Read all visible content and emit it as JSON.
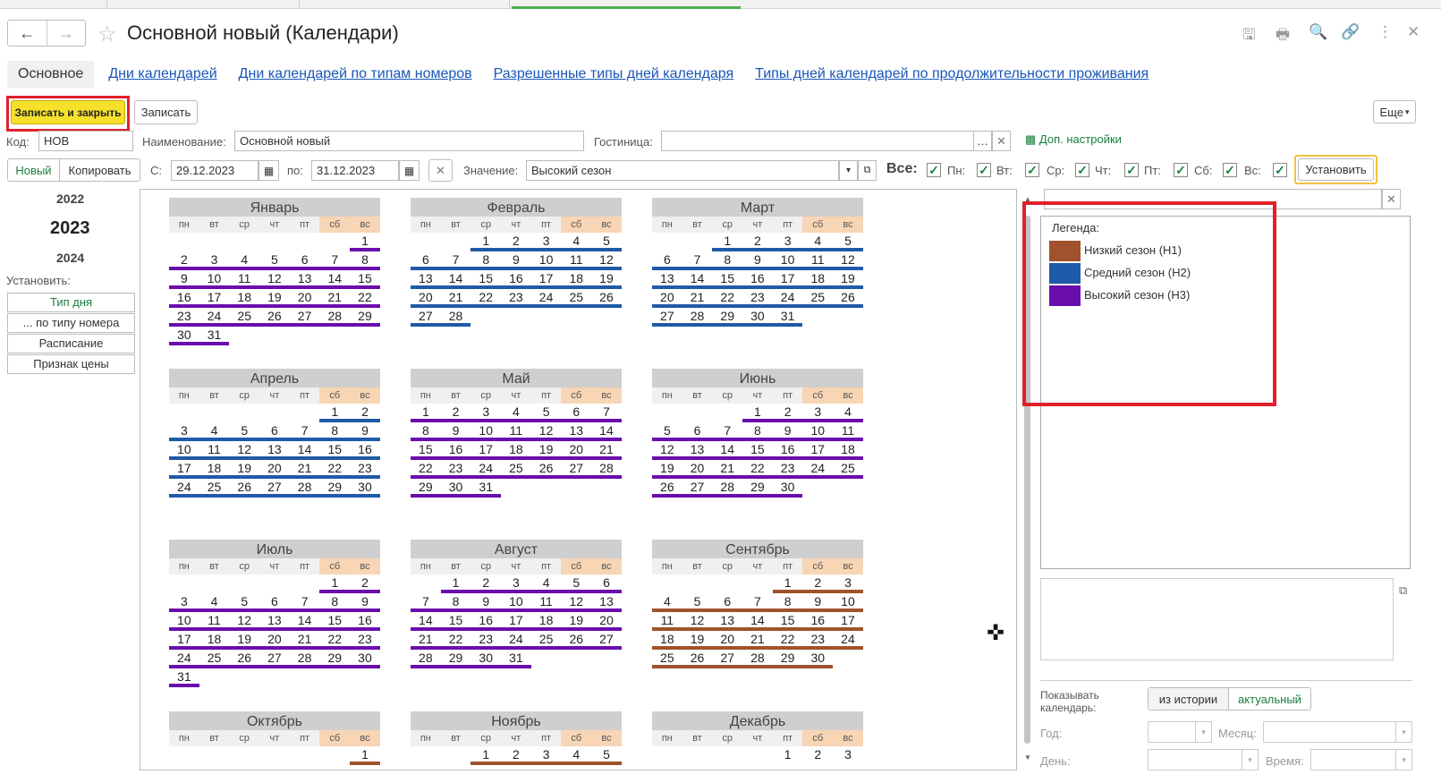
{
  "window": {
    "title": "Основной новый (Календари)"
  },
  "tabs": [
    {
      "label": "Основное"
    },
    {
      "label": "Дни календарей"
    },
    {
      "label": "Дни календарей по типам номеров"
    },
    {
      "label": "Разрешенные типы дней календаря"
    },
    {
      "label": "Типы дней календарей по продолжительности проживания"
    }
  ],
  "toolbar": {
    "save_close": "Записать и закрыть",
    "save": "Записать",
    "more": "Еще"
  },
  "form": {
    "code_label": "Код:",
    "code_value": "НОВ",
    "name_label": "Наименование:",
    "name_value": "Основной новый",
    "hotel_label": "Гостиница:",
    "hotel_value": "",
    "extra_settings": "Доп. настройки",
    "new_btn": "Новый",
    "copy_btn": "Копировать",
    "from_label": "С:",
    "from_value": "29.12.2023",
    "to_label": "по:",
    "to_value": "31.12.2023",
    "value_label": "Значение:",
    "value_value": "Высокий сезон",
    "all_label": "Все:",
    "set_btn": "Установить",
    "days": [
      "Пн:",
      "Вт:",
      "Ср:",
      "Чт:",
      "Пт:",
      "Сб:",
      "Вс:"
    ]
  },
  "years": {
    "prev": "2022",
    "current": "2023",
    "next": "2024"
  },
  "side": {
    "set_label": "Установить:",
    "items": [
      "Тип дня",
      "... по типу номера",
      "Расписание",
      "Признак цены"
    ]
  },
  "legend": {
    "title": "Легенда:",
    "items": [
      {
        "label": "Низкий сезон (Н1)",
        "color": "#a0522d"
      },
      {
        "label": "Средний сезон (Н2)",
        "color": "#1f5aa8"
      },
      {
        "label": "Высокий сезон (Н3)",
        "color": "#6a0dad"
      }
    ]
  },
  "show": {
    "label_line1": "Показывать",
    "label_line2": "календарь:",
    "history_btn": "из истории",
    "actual_btn": "актуальный",
    "year_label": "Год:",
    "month_label": "Месяц:",
    "day_label": "День:",
    "time_label": "Время:"
  },
  "weekdays": [
    "пн",
    "вт",
    "ср",
    "чт",
    "пт",
    "сб",
    "вс"
  ],
  "months": [
    {
      "name": "Январь",
      "start": 6,
      "len": 31,
      "seasons": [
        "Н3",
        "Н3",
        "Н3",
        "Н3",
        "Н3",
        "Н3",
        "Н3",
        "Н3",
        "Н3",
        "Н3",
        "Н3",
        "Н3",
        "Н3",
        "Н3",
        "Н3",
        "Н3",
        "Н3",
        "Н3",
        "Н3",
        "Н3",
        "Н3",
        "Н3",
        "Н3",
        "Н3",
        "Н3",
        "Н3",
        "Н3",
        "Н3",
        "Н3",
        "Н3",
        "Н3"
      ]
    },
    {
      "name": "Февраль",
      "start": 2,
      "len": 28,
      "seasons": [
        "Н2",
        "Н2",
        "Н2",
        "Н2",
        "Н2",
        "Н2",
        "Н2",
        "Н2",
        "Н2",
        "Н2",
        "Н2",
        "Н2",
        "Н2",
        "Н2",
        "Н2",
        "Н2",
        "Н2",
        "Н2",
        "Н2",
        "Н2",
        "Н2",
        "Н2",
        "Н2",
        "Н2",
        "Н2",
        "Н2",
        "Н2",
        "Н2"
      ]
    },
    {
      "name": "Март",
      "start": 2,
      "len": 31,
      "seasons": [
        "Н2",
        "Н2",
        "Н2",
        "Н2",
        "Н2",
        "Н2",
        "Н2",
        "Н2",
        "Н2",
        "Н2",
        "Н2",
        "Н2",
        "Н2",
        "Н2",
        "Н2",
        "Н2",
        "Н2",
        "Н2",
        "Н2",
        "Н2",
        "Н2",
        "Н2",
        "Н2",
        "Н2",
        "Н2",
        "Н2",
        "Н2",
        "Н2",
        "Н2",
        "Н2",
        "Н2"
      ]
    },
    {
      "name": "Апрель",
      "start": 5,
      "len": 30,
      "seasons": [
        "Н2",
        "Н2",
        "Н2",
        "Н2",
        "Н2",
        "Н2",
        "Н2",
        "Н2",
        "Н2",
        "Н2",
        "Н2",
        "Н2",
        "Н2",
        "Н2",
        "Н2",
        "Н2",
        "Н2",
        "Н2",
        "Н2",
        "Н2",
        "Н2",
        "Н2",
        "Н2",
        "Н2",
        "Н2",
        "Н2",
        "Н2",
        "Н2",
        "Н2",
        "Н2"
      ]
    },
    {
      "name": "Май",
      "start": 0,
      "len": 31,
      "seasons": [
        "Н3",
        "Н3",
        "Н3",
        "Н3",
        "Н3",
        "Н3",
        "Н3",
        "Н3",
        "Н3",
        "Н3",
        "Н3",
        "Н3",
        "Н3",
        "Н3",
        "Н3",
        "Н3",
        "Н3",
        "Н3",
        "Н3",
        "Н3",
        "Н3",
        "Н3",
        "Н3",
        "Н3",
        "Н3",
        "Н3",
        "Н3",
        "Н3",
        "Н3",
        "Н3",
        "Н3"
      ]
    },
    {
      "name": "Июнь",
      "start": 3,
      "len": 30,
      "seasons": [
        "Н3",
        "Н3",
        "Н3",
        "Н3",
        "Н3",
        "Н3",
        "Н3",
        "Н3",
        "Н3",
        "Н3",
        "Н3",
        "Н3",
        "Н3",
        "Н3",
        "Н3",
        "Н3",
        "Н3",
        "Н3",
        "Н3",
        "Н3",
        "Н3",
        "Н3",
        "Н3",
        "Н3",
        "Н3",
        "Н3",
        "Н3",
        "Н3",
        "Н3",
        "Н3"
      ]
    },
    {
      "name": "Июль",
      "start": 5,
      "len": 31,
      "seasons": [
        "Н3",
        "Н3",
        "Н3",
        "Н3",
        "Н3",
        "Н3",
        "Н3",
        "Н3",
        "Н3",
        "Н3",
        "Н3",
        "Н3",
        "Н3",
        "Н3",
        "Н3",
        "Н3",
        "Н3",
        "Н3",
        "Н3",
        "Н3",
        "Н3",
        "Н3",
        "Н3",
        "Н3",
        "Н3",
        "Н3",
        "Н3",
        "Н3",
        "Н3",
        "Н3",
        "Н3"
      ]
    },
    {
      "name": "Август",
      "start": 1,
      "len": 31,
      "seasons": [
        "Н3",
        "Н3",
        "Н3",
        "Н3",
        "Н3",
        "Н3",
        "Н3",
        "Н3",
        "Н3",
        "Н3",
        "Н3",
        "Н3",
        "Н3",
        "Н3",
        "Н3",
        "Н3",
        "Н3",
        "Н3",
        "Н3",
        "Н3",
        "Н3",
        "Н3",
        "Н3",
        "Н3",
        "Н3",
        "Н3",
        "Н3",
        "Н3",
        "Н3",
        "Н3",
        "Н3"
      ]
    },
    {
      "name": "Сентябрь",
      "start": 4,
      "len": 30,
      "seasons": [
        "Н1",
        "Н1",
        "Н1",
        "Н1",
        "Н1",
        "Н1",
        "Н1",
        "Н1",
        "Н1",
        "Н1",
        "Н1",
        "Н1",
        "Н1",
        "Н1",
        "Н1",
        "Н1",
        "Н1",
        "Н1",
        "Н1",
        "Н1",
        "Н1",
        "Н1",
        "Н1",
        "Н1",
        "Н1",
        "Н1",
        "Н1",
        "Н1",
        "Н1",
        "Н1"
      ]
    },
    {
      "name": "Октябрь",
      "start": 6,
      "len": 1,
      "seasons": [
        "Н1"
      ]
    },
    {
      "name": "Ноябрь",
      "start": 2,
      "len": 5,
      "seasons": [
        "Н1",
        "Н1",
        "Н1",
        "Н1",
        "Н1"
      ]
    },
    {
      "name": "Декабрь",
      "start": 4,
      "len": 3,
      "seasons": [
        "",
        "",
        ""
      ]
    }
  ]
}
